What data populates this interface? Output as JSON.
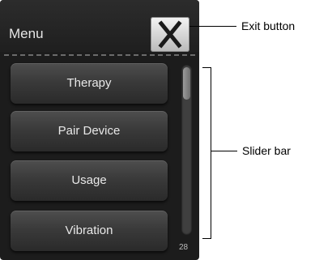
{
  "screen": {
    "header": {
      "title": "Menu",
      "exit_icon": "close-x-icon"
    },
    "menu_items": [
      {
        "label": "Therapy"
      },
      {
        "label": "Pair Device"
      },
      {
        "label": "Usage"
      },
      {
        "label": "Vibration"
      }
    ],
    "scrollbar": {
      "position": 0.0
    },
    "corner_number": "28"
  },
  "annotations": {
    "exit_button": "Exit button",
    "slider_bar": "Slider bar"
  }
}
